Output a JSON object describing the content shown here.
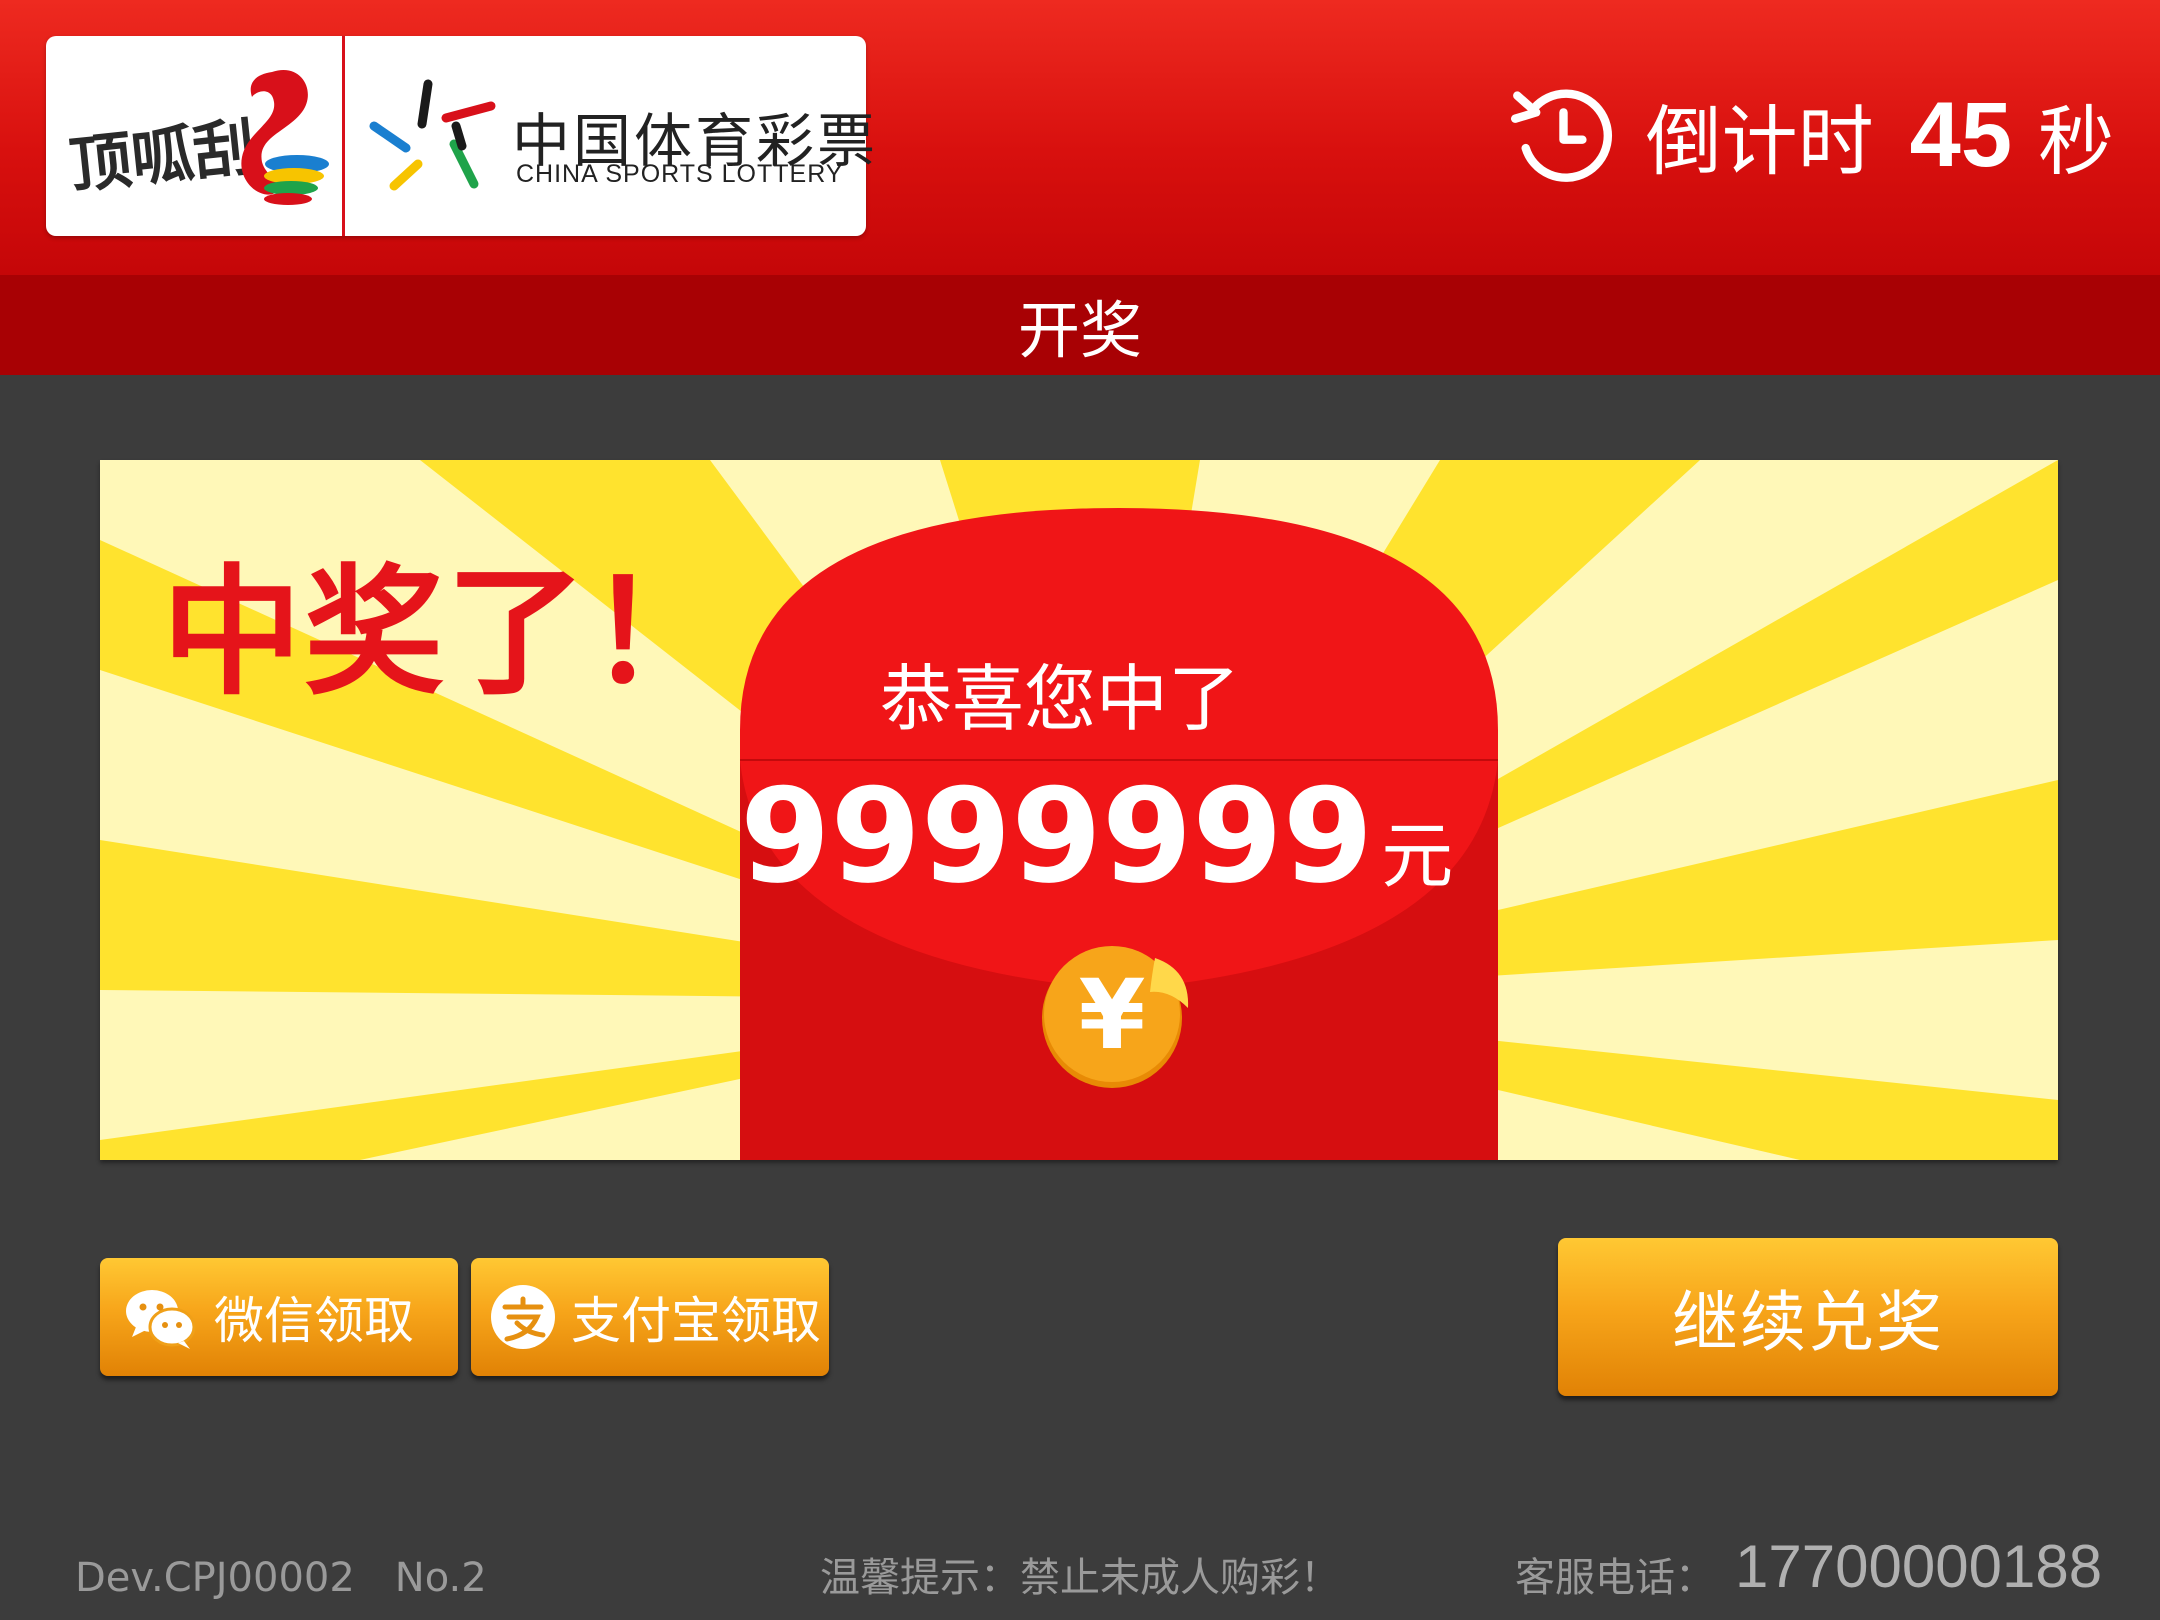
{
  "header": {
    "brand_logo": "顶呱刮",
    "lottery_name_cn": "中国体育彩票",
    "lottery_name_en": "CHINA SPORTS LOTTERY",
    "timer_label": "倒计时",
    "timer_value": "45",
    "timer_unit": "秒",
    "timer_icon": "clock-history-icon"
  },
  "subheader": {
    "title": "开奖"
  },
  "banner": {
    "headline": "中奖了！",
    "congrats": "恭喜您中了",
    "amount": "9999999",
    "amount_unit": "元",
    "coin_symbol": "¥",
    "colors": {
      "red": "#e5141a",
      "envelope_top": "#f01517",
      "envelope_body": "#d60e10",
      "yellow": "#ffe32e",
      "coin": "#f7a51a"
    }
  },
  "buttons": {
    "wechat_label": "微信领取",
    "wechat_icon": "wechat-icon",
    "alipay_label": "支付宝领取",
    "alipay_icon": "alipay-icon",
    "continue_label": "继续兑奖"
  },
  "footer": {
    "device": "Dev.CPJ00002　No.2",
    "tip": "温馨提示：禁止未成人购彩！",
    "phone_label": "客服电话：",
    "phone": "17700000188"
  }
}
